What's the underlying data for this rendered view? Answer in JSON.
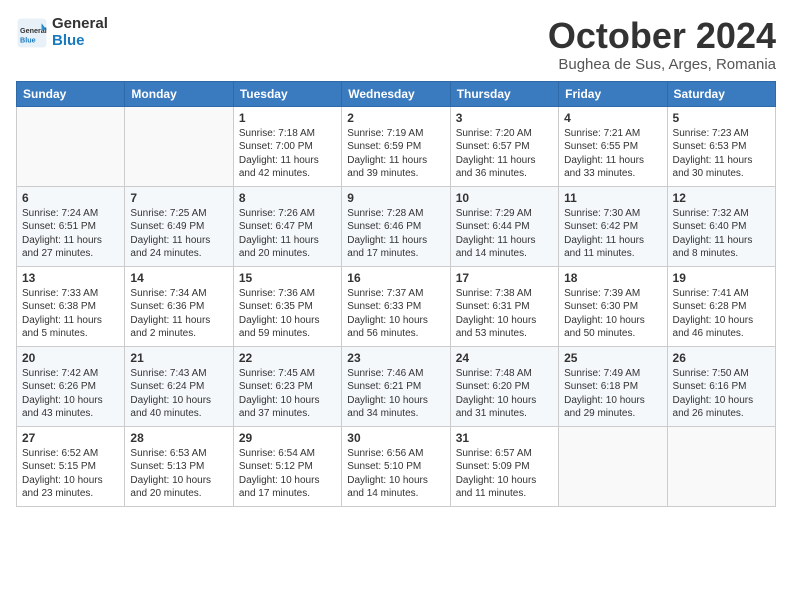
{
  "header": {
    "logo_line1": "General",
    "logo_line2": "Blue",
    "month": "October 2024",
    "location": "Bughea de Sus, Arges, Romania"
  },
  "columns": [
    "Sunday",
    "Monday",
    "Tuesday",
    "Wednesday",
    "Thursday",
    "Friday",
    "Saturday"
  ],
  "weeks": [
    [
      {
        "day": "",
        "info": ""
      },
      {
        "day": "",
        "info": ""
      },
      {
        "day": "1",
        "info": "Sunrise: 7:18 AM\nSunset: 7:00 PM\nDaylight: 11 hours and 42 minutes."
      },
      {
        "day": "2",
        "info": "Sunrise: 7:19 AM\nSunset: 6:59 PM\nDaylight: 11 hours and 39 minutes."
      },
      {
        "day": "3",
        "info": "Sunrise: 7:20 AM\nSunset: 6:57 PM\nDaylight: 11 hours and 36 minutes."
      },
      {
        "day": "4",
        "info": "Sunrise: 7:21 AM\nSunset: 6:55 PM\nDaylight: 11 hours and 33 minutes."
      },
      {
        "day": "5",
        "info": "Sunrise: 7:23 AM\nSunset: 6:53 PM\nDaylight: 11 hours and 30 minutes."
      }
    ],
    [
      {
        "day": "6",
        "info": "Sunrise: 7:24 AM\nSunset: 6:51 PM\nDaylight: 11 hours and 27 minutes."
      },
      {
        "day": "7",
        "info": "Sunrise: 7:25 AM\nSunset: 6:49 PM\nDaylight: 11 hours and 24 minutes."
      },
      {
        "day": "8",
        "info": "Sunrise: 7:26 AM\nSunset: 6:47 PM\nDaylight: 11 hours and 20 minutes."
      },
      {
        "day": "9",
        "info": "Sunrise: 7:28 AM\nSunset: 6:46 PM\nDaylight: 11 hours and 17 minutes."
      },
      {
        "day": "10",
        "info": "Sunrise: 7:29 AM\nSunset: 6:44 PM\nDaylight: 11 hours and 14 minutes."
      },
      {
        "day": "11",
        "info": "Sunrise: 7:30 AM\nSunset: 6:42 PM\nDaylight: 11 hours and 11 minutes."
      },
      {
        "day": "12",
        "info": "Sunrise: 7:32 AM\nSunset: 6:40 PM\nDaylight: 11 hours and 8 minutes."
      }
    ],
    [
      {
        "day": "13",
        "info": "Sunrise: 7:33 AM\nSunset: 6:38 PM\nDaylight: 11 hours and 5 minutes."
      },
      {
        "day": "14",
        "info": "Sunrise: 7:34 AM\nSunset: 6:36 PM\nDaylight: 11 hours and 2 minutes."
      },
      {
        "day": "15",
        "info": "Sunrise: 7:36 AM\nSunset: 6:35 PM\nDaylight: 10 hours and 59 minutes."
      },
      {
        "day": "16",
        "info": "Sunrise: 7:37 AM\nSunset: 6:33 PM\nDaylight: 10 hours and 56 minutes."
      },
      {
        "day": "17",
        "info": "Sunrise: 7:38 AM\nSunset: 6:31 PM\nDaylight: 10 hours and 53 minutes."
      },
      {
        "day": "18",
        "info": "Sunrise: 7:39 AM\nSunset: 6:30 PM\nDaylight: 10 hours and 50 minutes."
      },
      {
        "day": "19",
        "info": "Sunrise: 7:41 AM\nSunset: 6:28 PM\nDaylight: 10 hours and 46 minutes."
      }
    ],
    [
      {
        "day": "20",
        "info": "Sunrise: 7:42 AM\nSunset: 6:26 PM\nDaylight: 10 hours and 43 minutes."
      },
      {
        "day": "21",
        "info": "Sunrise: 7:43 AM\nSunset: 6:24 PM\nDaylight: 10 hours and 40 minutes."
      },
      {
        "day": "22",
        "info": "Sunrise: 7:45 AM\nSunset: 6:23 PM\nDaylight: 10 hours and 37 minutes."
      },
      {
        "day": "23",
        "info": "Sunrise: 7:46 AM\nSunset: 6:21 PM\nDaylight: 10 hours and 34 minutes."
      },
      {
        "day": "24",
        "info": "Sunrise: 7:48 AM\nSunset: 6:20 PM\nDaylight: 10 hours and 31 minutes."
      },
      {
        "day": "25",
        "info": "Sunrise: 7:49 AM\nSunset: 6:18 PM\nDaylight: 10 hours and 29 minutes."
      },
      {
        "day": "26",
        "info": "Sunrise: 7:50 AM\nSunset: 6:16 PM\nDaylight: 10 hours and 26 minutes."
      }
    ],
    [
      {
        "day": "27",
        "info": "Sunrise: 6:52 AM\nSunset: 5:15 PM\nDaylight: 10 hours and 23 minutes."
      },
      {
        "day": "28",
        "info": "Sunrise: 6:53 AM\nSunset: 5:13 PM\nDaylight: 10 hours and 20 minutes."
      },
      {
        "day": "29",
        "info": "Sunrise: 6:54 AM\nSunset: 5:12 PM\nDaylight: 10 hours and 17 minutes."
      },
      {
        "day": "30",
        "info": "Sunrise: 6:56 AM\nSunset: 5:10 PM\nDaylight: 10 hours and 14 minutes."
      },
      {
        "day": "31",
        "info": "Sunrise: 6:57 AM\nSunset: 5:09 PM\nDaylight: 10 hours and 11 minutes."
      },
      {
        "day": "",
        "info": ""
      },
      {
        "day": "",
        "info": ""
      }
    ]
  ]
}
